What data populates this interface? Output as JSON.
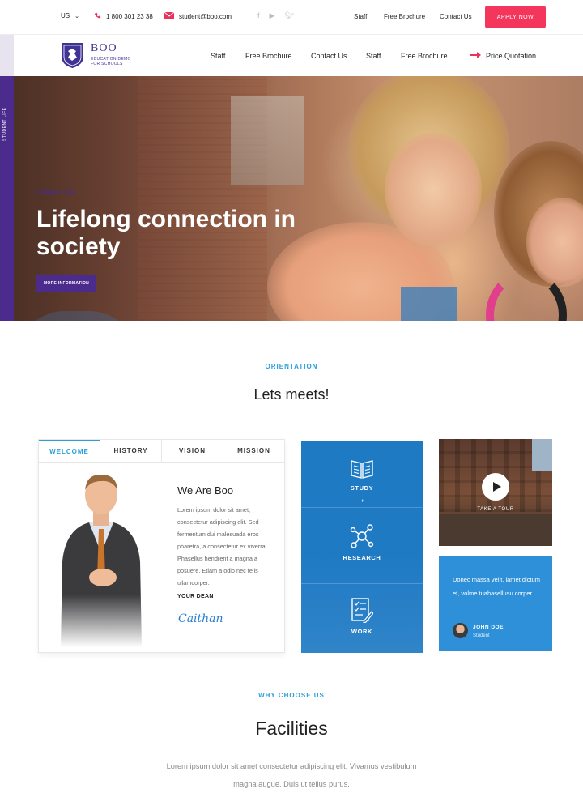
{
  "topbar": {
    "language": "US",
    "phone": "1 800 301 23 38",
    "email": "student@boo.com",
    "social_icons": [
      "facebook-icon",
      "youtube-icon",
      "twitter-icon"
    ],
    "links": [
      "Staff",
      "Free Brochure",
      "Contact Us"
    ],
    "apply_label": "APPLY NOW"
  },
  "brand": {
    "name": "BOO",
    "tagline": "EDUCATION DEMO FOR SCHOOLS"
  },
  "nav": {
    "links": [
      "Staff",
      "Free Brochure",
      "Contact Us",
      "Staff",
      "Free Brochure"
    ],
    "quote_label": "Price Quotation"
  },
  "hero": {
    "side_tag": "STUDENT LIFE",
    "kicker": "Campus Life",
    "title": "Lifelong connection in society",
    "button": "MORE INFORMATION"
  },
  "orientation": {
    "kicker": "ORIENTATION",
    "title": "Lets meets!"
  },
  "tabs_card": {
    "tabs": [
      "WELCOME",
      "HISTORY",
      "VISION",
      "MISSION"
    ],
    "active_tab": "WELCOME",
    "heading": "We Are Boo",
    "body": "Lorem ipsum dolor sit amet, consectetur adipiscing elit. Sed fermentum dui malesuada eros pharetra, a consectetur ex viverra. Phasellus hendrerit a magna a posuere. Etiam a odio nec felis ullamcorper.",
    "signature_label": "YOUR DEAN",
    "signature": "Caithan"
  },
  "programs": {
    "items": [
      {
        "label": "STUDY",
        "icon": "book-icon"
      },
      {
        "label": "RESEARCH",
        "icon": "network-icon"
      },
      {
        "label": "WORK",
        "icon": "checklist-icon"
      }
    ]
  },
  "video": {
    "label": "TAKE A TOUR"
  },
  "testimonial": {
    "text": "Donec massa velit, iamet dictum et, volme tuahasellusu corper.",
    "name": "JOHN DOE",
    "role": "Student"
  },
  "facilities": {
    "kicker": "WHY CHOOSE US",
    "title": "Facilities",
    "body": "Lorem ipsum dolor sit amet consectetur adipiscing elit. Vivamus vestibulum magna augue. Duis ut tellus purus."
  },
  "colors": {
    "accent_pink": "#f5365c",
    "brand_purple": "#4b2b8c",
    "accent_blue": "#2a9ed8",
    "panel_blue": "#1f7ac4"
  }
}
